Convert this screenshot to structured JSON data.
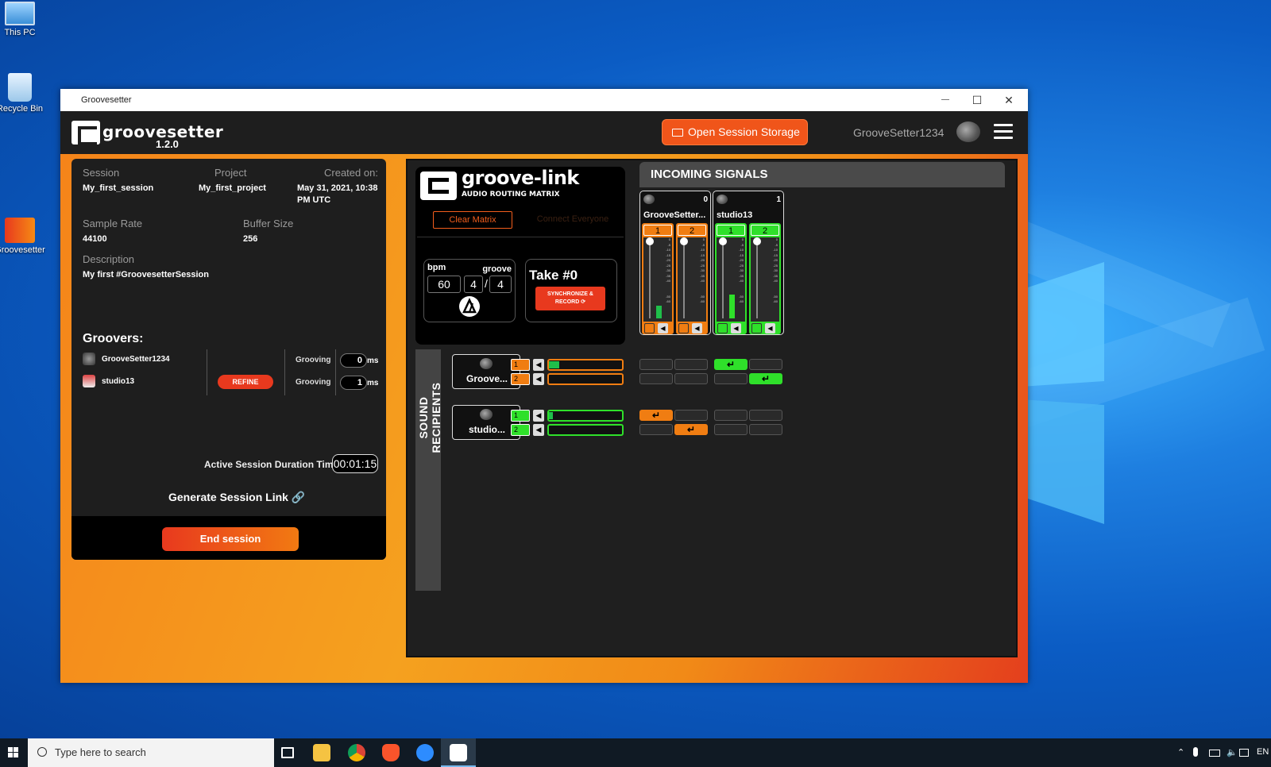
{
  "desktop": {
    "icons": [
      {
        "label": "This PC"
      },
      {
        "label": "Recycle Bin"
      },
      {
        "label": "Groovesetter"
      }
    ]
  },
  "window": {
    "title": "Groovesetter",
    "controls": {
      "minimize": "—",
      "maximize": "☐",
      "close": "✕"
    }
  },
  "appbar": {
    "brand": "groovesetter",
    "version": "1.2.0",
    "storage_button": "Open Session Storage",
    "username": "GrooveSetter1234"
  },
  "session": {
    "session_label": "Session",
    "session_value": "My_first_session",
    "project_label": "Project",
    "project_value": "My_first_project",
    "created_label": "Created on:",
    "created_value": "May 31, 2021, 10:38 PM UTC",
    "sample_rate_label": "Sample Rate",
    "sample_rate_value": "44100",
    "buffer_label": "Buffer Size",
    "buffer_value": "256",
    "description_label": "Description",
    "description_value": "My first #GroovesetterSession",
    "groovers_title": "Groovers:",
    "groovers": [
      {
        "name": "GrooveSetter1234",
        "status": "Grooving",
        "latency": "0",
        "unit": "ms"
      },
      {
        "name": "studio13",
        "status": "Grooving",
        "latency": "1",
        "unit": "ms"
      }
    ],
    "refine_button": "REFINE",
    "timer_label": "Active Session Duration Timer",
    "timer_value": "00:01:15",
    "generate_link": "Generate Session Link 🔗",
    "end_button": "End session"
  },
  "groovelink": {
    "title": "groove-link",
    "subtitle": "AUDIO ROUTING MATRIX",
    "clear_button": "Clear Matrix",
    "connect_button": "Connect Everyone",
    "bpm_label": "bpm",
    "groove_label": "groove",
    "bpm_value": "60",
    "groove_num": "4",
    "groove_den": "4",
    "take_label": "Take #0",
    "sync_button": "SYNCHRONIZE & RECORD ⟳"
  },
  "incoming": {
    "title": "INCOMING SIGNALS",
    "sources": [
      {
        "name": "GrooveSetter...",
        "count": "0",
        "color": "#f07d12",
        "channels": [
          {
            "num": "1",
            "level": 0.16
          },
          {
            "num": "2",
            "level": 0.0
          }
        ]
      },
      {
        "name": "studio13",
        "count": "1",
        "color": "#2fe02a",
        "channels": [
          {
            "num": "1",
            "level": 0.3
          },
          {
            "num": "2",
            "level": 0.0
          }
        ]
      }
    ],
    "ticks": [
      "0",
      "-5",
      "-10",
      "-15",
      "-20",
      "-25",
      "-30",
      "-35",
      "-40",
      "",
      "",
      "-50",
      "-60"
    ]
  },
  "recipients": {
    "tab_label": "SOUND   RECIPIENTS",
    "list": [
      {
        "name": "Groove...",
        "color": "#f07d12",
        "channels": [
          {
            "num": "1",
            "level": 0.14
          },
          {
            "num": "2",
            "level": 0.0
          }
        ]
      },
      {
        "name": "studio...",
        "color": "#2fe02a",
        "channels": [
          {
            "num": "1",
            "level": 0.05
          },
          {
            "num": "2",
            "level": 0.0
          }
        ]
      }
    ],
    "route_glyph": "↵"
  },
  "taskbar": {
    "search_placeholder": "Type here to search",
    "lang": "EN"
  },
  "colors": {
    "orange": "#f07d12",
    "green": "#2fe02a",
    "red": "#e8391e",
    "panel": "#1e1e1e"
  }
}
